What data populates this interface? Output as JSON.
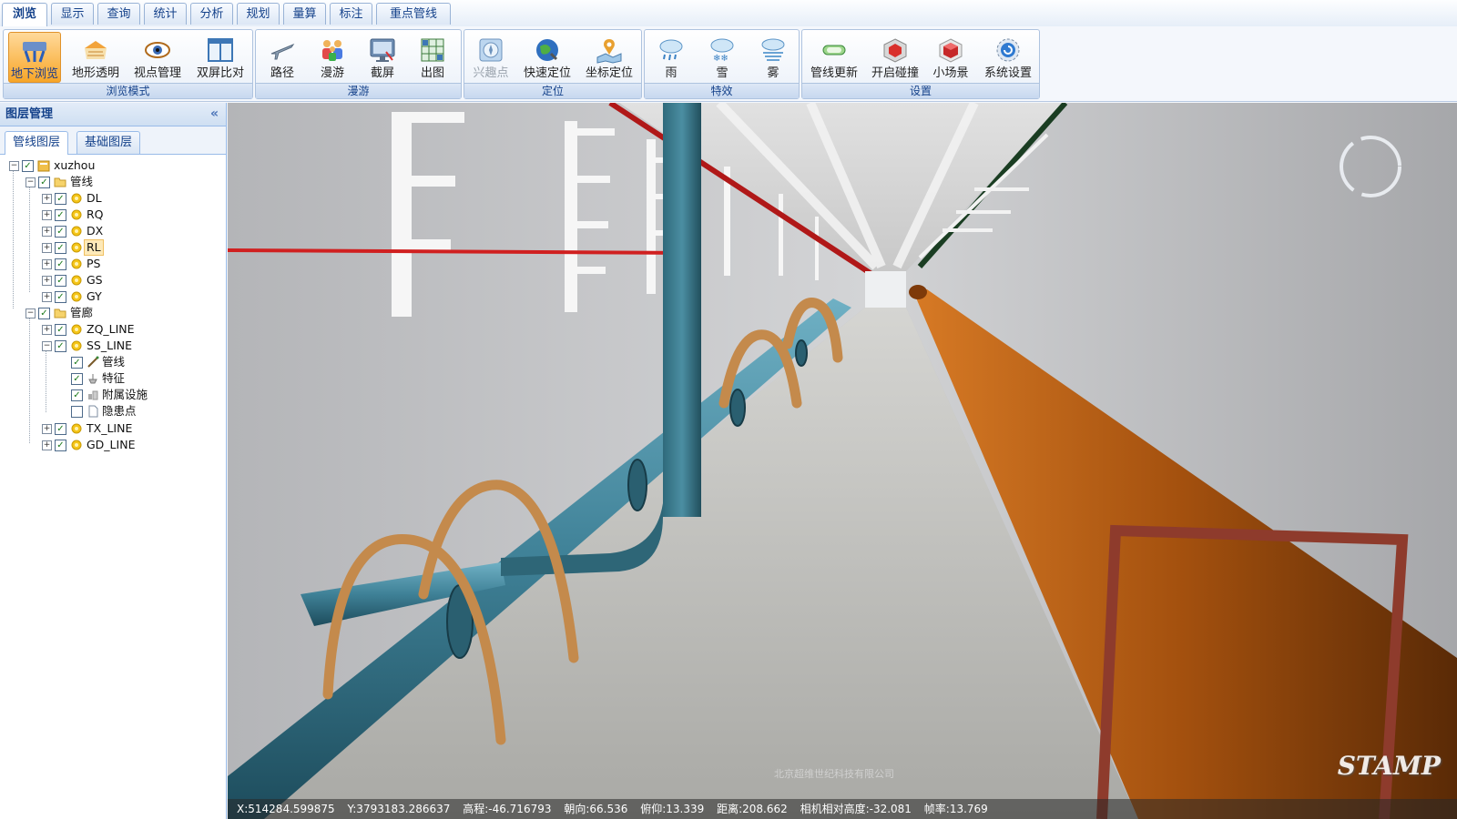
{
  "tabs": [
    {
      "label": "浏览",
      "active": true
    },
    {
      "label": "显示"
    },
    {
      "label": "查询"
    },
    {
      "label": "统计"
    },
    {
      "label": "分析"
    },
    {
      "label": "规划"
    },
    {
      "label": "量算"
    },
    {
      "label": "标注"
    },
    {
      "label": "重点管线"
    }
  ],
  "ribbon": {
    "groups": [
      {
        "label": "浏览模式",
        "buttons": [
          {
            "label": "地下浏览",
            "icon": "underground-icon",
            "active": true
          },
          {
            "label": "地形透明",
            "icon": "terrain-transparent-icon"
          },
          {
            "label": "视点管理",
            "icon": "eye-icon"
          },
          {
            "label": "双屏比对",
            "icon": "split-screen-icon"
          }
        ]
      },
      {
        "label": "漫游",
        "buttons": [
          {
            "label": "路径",
            "icon": "airplane-icon"
          },
          {
            "label": "漫游",
            "icon": "people-icon"
          },
          {
            "label": "截屏",
            "icon": "monitor-icon"
          },
          {
            "label": "出图",
            "icon": "map-grid-icon"
          }
        ]
      },
      {
        "label": "定位",
        "buttons": [
          {
            "label": "兴趣点",
            "icon": "compass-icon",
            "disabled": true
          },
          {
            "label": "快速定位",
            "icon": "globe-icon"
          },
          {
            "label": "坐标定位",
            "icon": "map-pin-icon"
          }
        ]
      },
      {
        "label": "特效",
        "buttons": [
          {
            "label": "雨",
            "icon": "rain-icon"
          },
          {
            "label": "雪",
            "icon": "snow-icon"
          },
          {
            "label": "雾",
            "icon": "fog-icon"
          }
        ]
      },
      {
        "label": "设置",
        "buttons": [
          {
            "label": "管线更新",
            "icon": "pipe-update-icon"
          },
          {
            "label": "开启碰撞",
            "icon": "cube-red-icon"
          },
          {
            "label": "小场景",
            "icon": "cube-scene-icon"
          },
          {
            "label": "系统设置",
            "icon": "settings-icon"
          }
        ]
      }
    ]
  },
  "panel": {
    "title": "图层管理",
    "tabs": [
      "管线图层",
      "基础图层"
    ],
    "tree": [
      {
        "label": "xuzhou",
        "level": 0,
        "expander": "−",
        "checked": true,
        "icon": "database-icon"
      },
      {
        "label": "管线",
        "level": 1,
        "expander": "−",
        "checked": true,
        "icon": "folder-icon"
      },
      {
        "label": "DL",
        "level": 2,
        "expander": "+",
        "checked": true,
        "icon": "layer-icon"
      },
      {
        "label": "RQ",
        "level": 2,
        "expander": "+",
        "checked": true,
        "icon": "layer-icon"
      },
      {
        "label": "DX",
        "level": 2,
        "expander": "+",
        "checked": true,
        "icon": "layer-icon"
      },
      {
        "label": "RL",
        "level": 2,
        "expander": "+",
        "checked": true,
        "icon": "layer-icon",
        "selected": true
      },
      {
        "label": "PS",
        "level": 2,
        "expander": "+",
        "checked": true,
        "icon": "layer-icon"
      },
      {
        "label": "GS",
        "level": 2,
        "expander": "+",
        "checked": true,
        "icon": "layer-icon"
      },
      {
        "label": "GY",
        "level": 2,
        "expander": "+",
        "checked": true,
        "icon": "layer-icon"
      },
      {
        "label": "管廊",
        "level": 1,
        "expander": "−",
        "checked": true,
        "icon": "folder-icon"
      },
      {
        "label": "ZQ_LINE",
        "level": 2,
        "expander": "+",
        "checked": true,
        "icon": "layer-icon"
      },
      {
        "label": "SS_LINE",
        "level": 2,
        "expander": "−",
        "checked": true,
        "icon": "layer-icon"
      },
      {
        "label": "管线",
        "level": 3,
        "expander": "",
        "checked": true,
        "icon": "line-icon"
      },
      {
        "label": "特征",
        "level": 3,
        "expander": "",
        "checked": true,
        "icon": "feature-icon"
      },
      {
        "label": "附属设施",
        "level": 3,
        "expander": "",
        "checked": true,
        "icon": "facility-icon"
      },
      {
        "label": "隐患点",
        "level": 3,
        "expander": "",
        "checked": false,
        "icon": "document-icon"
      },
      {
        "label": "TX_LINE",
        "level": 2,
        "expander": "+",
        "checked": true,
        "icon": "layer-icon"
      },
      {
        "label": "GD_LINE",
        "level": 2,
        "expander": "+",
        "checked": true,
        "icon": "layer-icon"
      }
    ]
  },
  "status": {
    "x": "X:514284.599875",
    "y": "Y:3793183.286637",
    "elevation": "高程:-46.716793",
    "heading": "朝向:66.536",
    "pitch": "俯仰:13.339",
    "distance": "距离:208.662",
    "camera_height": "相机相对高度:-32.081",
    "frame_rate": "帧率:13.769"
  },
  "watermark": "STAMP",
  "copyright": "北京超维世纪科技有限公司",
  "colors": {
    "accent": "#15428b",
    "active_button": "#f7a628",
    "water_pipe": "#3f7f94",
    "heat_pipe": "#b55a10"
  }
}
